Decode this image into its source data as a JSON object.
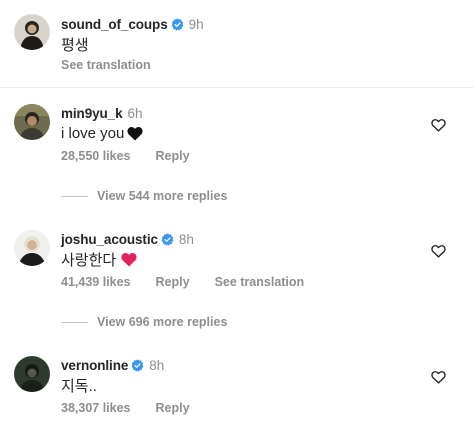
{
  "caption": {
    "username": "sound_of_coups",
    "time": "9h",
    "text": "평생",
    "translation": "See translation"
  },
  "comments": [
    {
      "username": "min9yu_k",
      "verified": false,
      "time": "6h",
      "text": "i love you",
      "emoji": "black-heart",
      "likes": "28,550 likes",
      "reply": "Reply",
      "view_replies": "View 544 more replies"
    },
    {
      "username": "joshu_acoustic",
      "verified": true,
      "time": "8h",
      "text": "사랑한다",
      "emoji": "red-heart",
      "likes": "41,439 likes",
      "reply": "Reply",
      "translation": "See translation",
      "view_replies": "View 696 more replies"
    },
    {
      "username": "vernonline",
      "verified": true,
      "time": "8h",
      "text": "지독..",
      "likes": "38,307 likes",
      "reply": "Reply"
    }
  ],
  "colors": {
    "verified_blue": "#3897f0",
    "secondary_text": "#8e8e8e",
    "primary_text": "#262626",
    "red_heart": "#e0245e"
  }
}
